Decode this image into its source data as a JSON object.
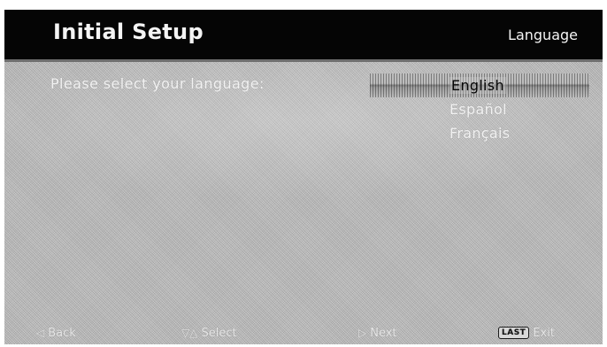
{
  "header": {
    "title": "Initial Setup",
    "section": "Language"
  },
  "prompt": "Please select your language:",
  "languages": {
    "selected": "English",
    "options": [
      "English",
      "Español",
      "Français"
    ]
  },
  "footer": {
    "back": {
      "icon": "left-arrow-icon",
      "label": "Back"
    },
    "select": {
      "icon": "up-down-arrows-icon",
      "label": "Select"
    },
    "next": {
      "icon": "right-arrow-icon",
      "label": "Next"
    },
    "exit": {
      "key": "LAST",
      "label": "Exit"
    }
  },
  "colors": {
    "header_bg": "#050505",
    "screen_bg": "#c2c2c2",
    "text_light": "#f2f2f2"
  }
}
